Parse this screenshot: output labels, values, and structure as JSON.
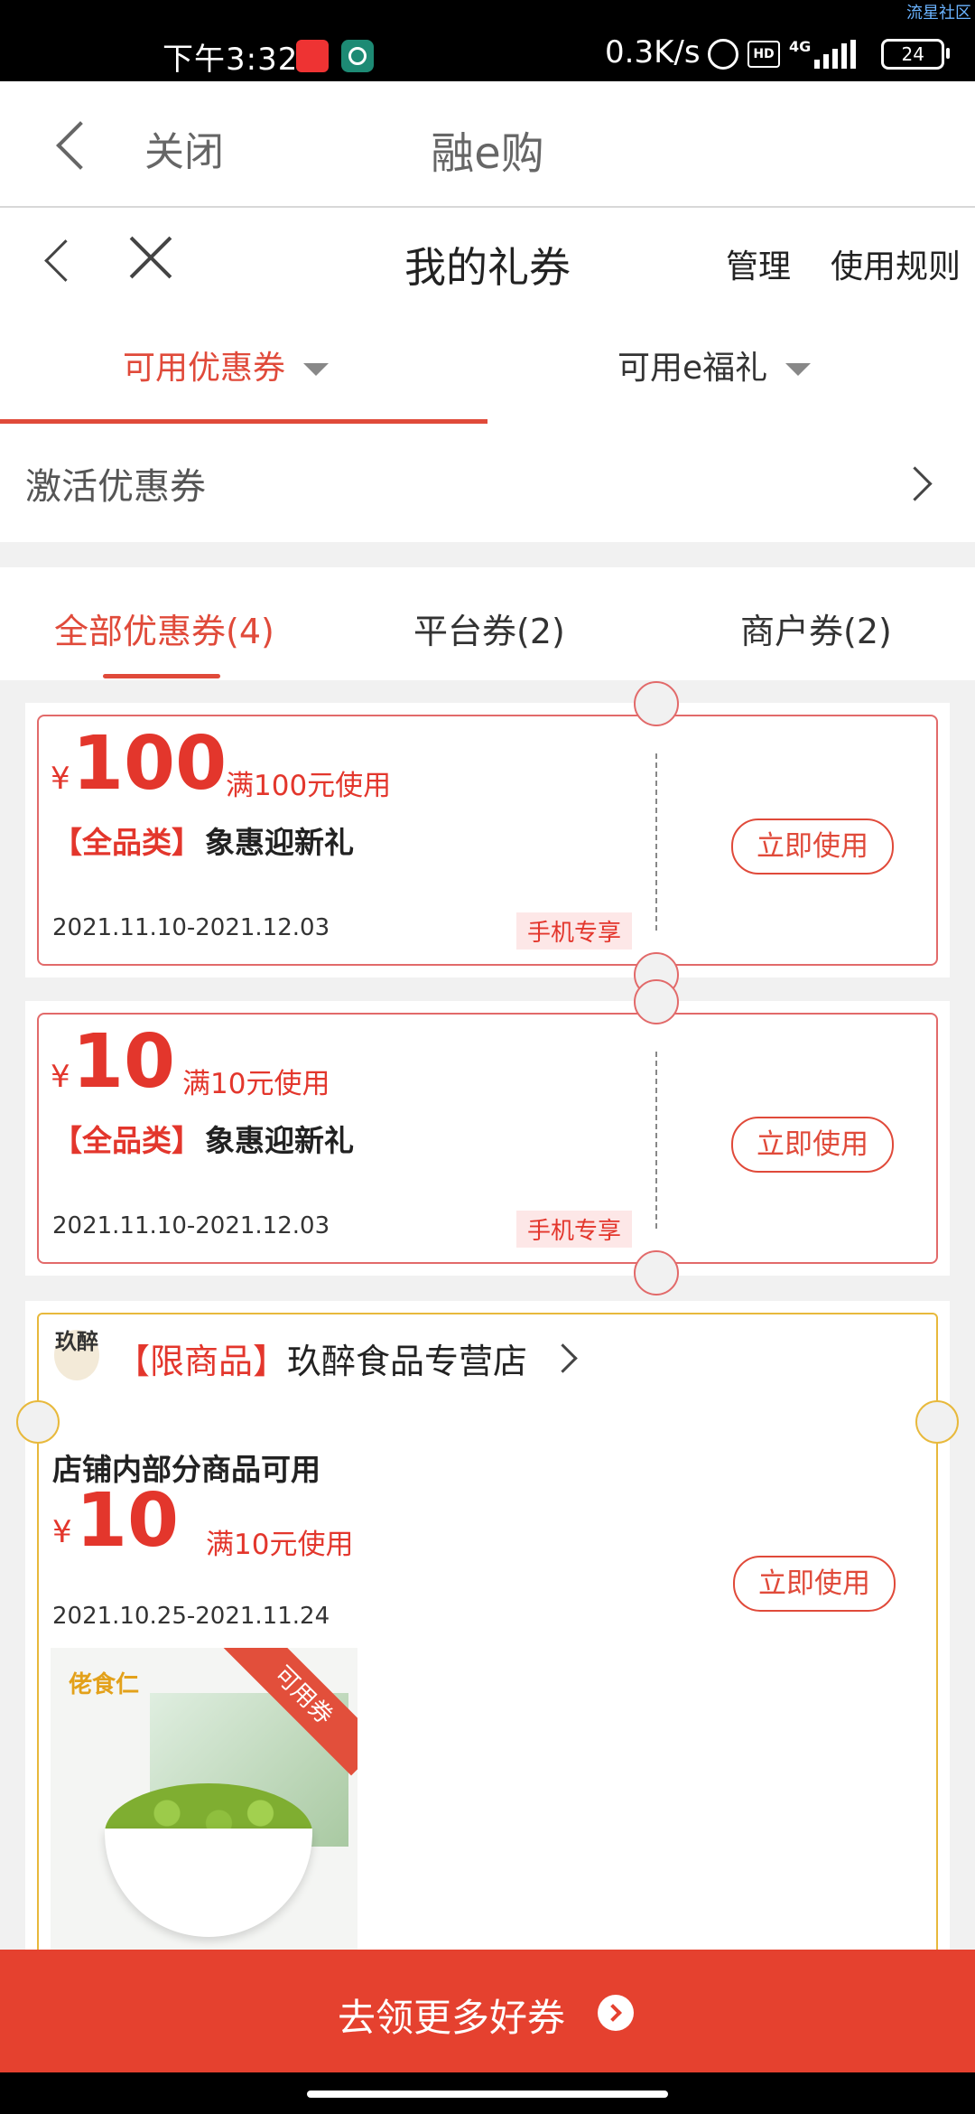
{
  "status_bar": {
    "time": "下午3:32",
    "net_speed": "0.3K/s",
    "signal_type": "4G",
    "hd_label": "HD",
    "battery": "24",
    "watermark": "流星社区"
  },
  "top_nav": {
    "close_label": "关闭",
    "title": "融e购"
  },
  "page_header": {
    "title": "我的礼券",
    "manage_label": "管理",
    "rules_label": "使用规则"
  },
  "type_tabs": [
    {
      "label": "可用优惠券",
      "active": true
    },
    {
      "label": "可用e福礼",
      "active": false
    }
  ],
  "activate": {
    "label": "激活优惠券"
  },
  "sub_tabs": [
    {
      "label": "全部优惠券(4)",
      "active": true
    },
    {
      "label": "平台券(2)",
      "active": false
    },
    {
      "label": "商户券(2)",
      "active": false
    }
  ],
  "coupons": [
    {
      "currency": "¥",
      "amount": "100",
      "condition": "满100元使用",
      "category": "【全品类】",
      "name": "象惠迎新礼",
      "date_range": "2021.11.10-2021.12.03",
      "badge": "手机专享",
      "button": "立即使用"
    },
    {
      "currency": "¥",
      "amount": "10",
      "condition": "满10元使用",
      "category": "【全品类】",
      "name": "象惠迎新礼",
      "date_range": "2021.11.10-2021.12.03",
      "badge": "手机专享",
      "button": "立即使用"
    }
  ],
  "shop_coupon": {
    "logo_text": "玖醉",
    "tag": "【限商品】",
    "shop_name": "玖醉食品专营店",
    "scope": "店铺内部分商品可用",
    "currency": "¥",
    "amount": "10",
    "condition": "满10元使用",
    "date_range": "2021.10.25-2021.11.24",
    "button": "立即使用",
    "product_brand": "佬食仁",
    "product_ribbon": "可用券"
  },
  "bottom": {
    "label": "去领更多好券"
  },
  "colors": {
    "accent": "#e04a3a",
    "bottom_bar": "#e5412f",
    "shop_frame": "#e8b93c"
  }
}
